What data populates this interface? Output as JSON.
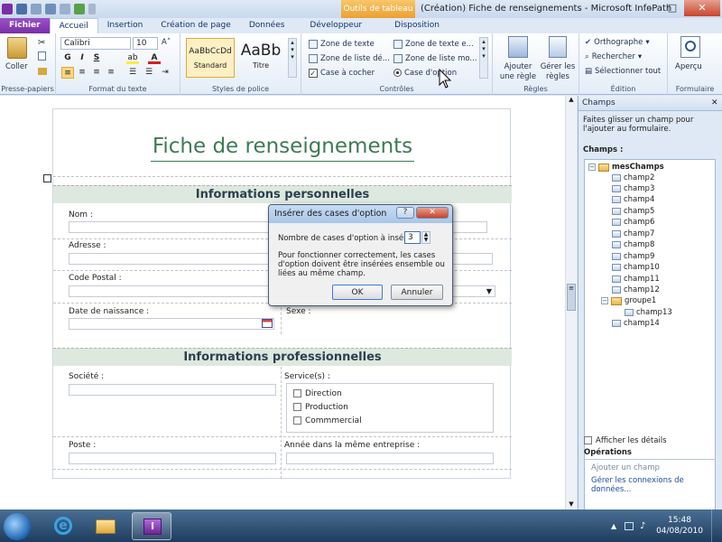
{
  "window": {
    "title": "(Création) Fiche de renseignements - Microsoft InfoPath",
    "context_tab": "Outils de tableau"
  },
  "tabs": [
    "Fichier",
    "Accueil",
    "Insertion",
    "Création de page",
    "Données",
    "Développeur",
    "Disposition"
  ],
  "ribbon": {
    "clipboard": {
      "paste": "Coller",
      "label": "Presse-papiers"
    },
    "font": {
      "name": "Calibri",
      "size": "10",
      "bold": "G",
      "italic": "I",
      "underline": "S",
      "label": "Format du texte"
    },
    "styles": {
      "normal": "Standard",
      "normal_sample": "AaBbCcDd",
      "title": "Titre",
      "title_sample": "AaBb",
      "label": "Styles de police"
    },
    "controls": {
      "items": [
        "Zone de texte",
        "Zone de liste dé...",
        "Case à cocher",
        "Zone de texte e...",
        "Zone de liste mo...",
        "Case d'option"
      ],
      "label": "Contrôles"
    },
    "rules": {
      "add_rule": "Ajouter une règle",
      "manage": "Gérer les règles",
      "label": "Règles"
    },
    "editing": {
      "spelling": "Orthographe",
      "find": "Rechercher",
      "select_all": "Sélectionner tout",
      "label": "Édition"
    },
    "form": {
      "preview": "Aperçu",
      "label": "Formulaire"
    }
  },
  "form": {
    "title": "Fiche de renseignements",
    "section1": "Informations personnelles",
    "section2": "Informations professionnelles",
    "labels": {
      "nom": "Nom :",
      "adresse": "Adresse :",
      "code_postal": "Code Postal :",
      "date_naissance": "Date de naissance :",
      "sexe": "Sexe :",
      "societe": "Société :",
      "services": "Service(s) :",
      "poste": "Poste :",
      "annee": "Année dans la même entreprise :"
    },
    "services": [
      "Direction",
      "Production",
      "Commmercial"
    ]
  },
  "dialog": {
    "title": "Insérer des cases d'option",
    "help": "?",
    "close": "✕",
    "count_label": "Nombre de cases d'option à insérer :",
    "count_value": "3",
    "message": "Pour fonctionner correctement, les cases d'option doivent être insérées ensemble ou liées au même champ.",
    "ok": "OK",
    "cancel": "Annuler"
  },
  "panel": {
    "title": "Champs",
    "hint": "Faites glisser un champ pour l'ajouter au formulaire.",
    "fields_label": "Champs :",
    "root": "mesChamps",
    "fields": [
      "champ2",
      "champ3",
      "champ4",
      "champ5",
      "champ6",
      "champ7",
      "champ8",
      "champ9",
      "champ10",
      "champ11",
      "champ12"
    ],
    "group": "groupe1",
    "group_fields": [
      "champ13"
    ],
    "after_group": [
      "champ14"
    ],
    "show_details": "Afficher les détails",
    "operations": "Opérations",
    "add_field": "Ajouter un champ",
    "manage_connections": "Gérer les connexions de données..."
  },
  "taskbar": {
    "time": "15:48",
    "date": "04/08/2010"
  }
}
